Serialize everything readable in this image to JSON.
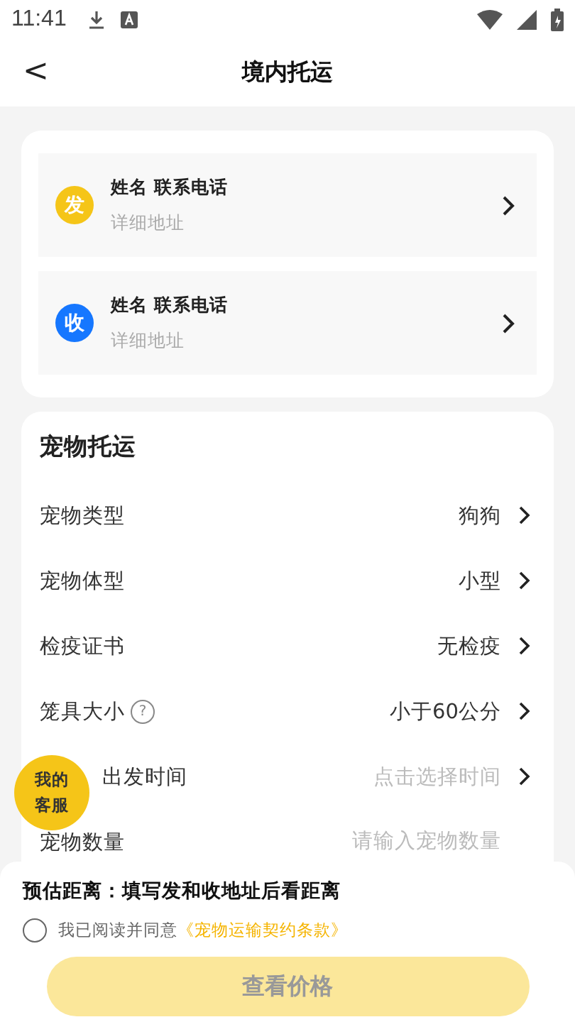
{
  "status_bar": {
    "time": "11:41"
  },
  "header": {
    "title": "境内托运",
    "back": "<"
  },
  "addresses": [
    {
      "badge": "发",
      "color": "#f5c518",
      "name": "姓名 联系电话",
      "detail": "详细地址"
    },
    {
      "badge": "收",
      "color": "#1677ff",
      "name": "姓名 联系电话",
      "detail": "详细地址"
    }
  ],
  "pet_section": {
    "title": "宠物托运",
    "rows": [
      {
        "kind": "select",
        "label": "宠物类型",
        "value": "狗狗"
      },
      {
        "kind": "select",
        "label": "宠物体型",
        "value": "小型"
      },
      {
        "kind": "select",
        "label": "检疫证书",
        "value": "无检疫"
      },
      {
        "kind": "select",
        "label": "笼具大小",
        "value": "小于60公分",
        "help": "?"
      },
      {
        "kind": "time",
        "label": "出发时间",
        "placeholder": "点击选择时间"
      },
      {
        "kind": "input",
        "label": "宠物数量",
        "placeholder": "请输入宠物数量"
      }
    ]
  },
  "service_button": {
    "lines": [
      "我的",
      "客服"
    ]
  },
  "footer": {
    "distance": "预估距离：填写发和收地址后看距离",
    "agree": {
      "checked": false,
      "text": "我已阅读并同意",
      "link": "《宠物运输契约条款》"
    },
    "button": {
      "label": "查看价格",
      "disabled": true
    }
  }
}
